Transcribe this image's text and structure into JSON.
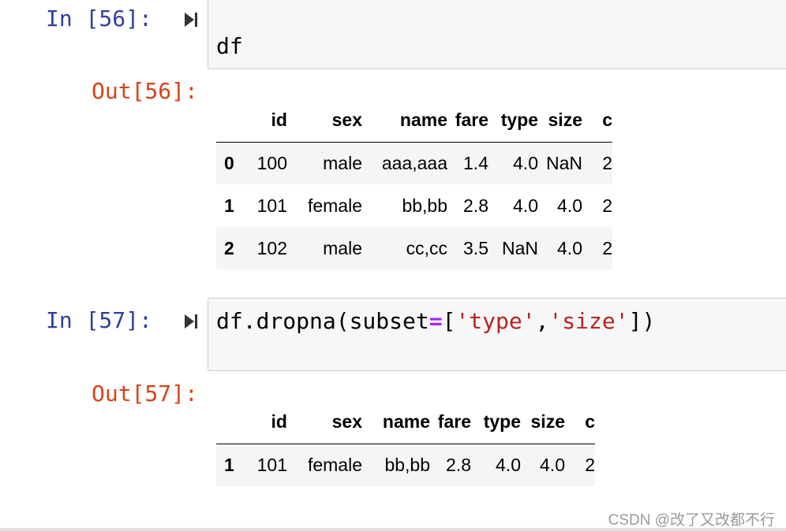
{
  "cells": [
    {
      "in_prompt": "In [56]:",
      "out_prompt": "Out[56]:",
      "code_tokens": [
        {
          "t": "df",
          "k": "plain"
        }
      ],
      "table": {
        "columns": [
          "",
          "id",
          "sex",
          "name",
          "fare",
          "type",
          "size",
          "c"
        ],
        "rows": [
          [
            "0",
            "100",
            "male",
            "aaa,aaa",
            "1.4",
            "4.0",
            "NaN",
            "2"
          ],
          [
            "1",
            "101",
            "female",
            "bb,bb",
            "2.8",
            "4.0",
            "4.0",
            "2"
          ],
          [
            "2",
            "102",
            "male",
            "cc,cc",
            "3.5",
            "NaN",
            "4.0",
            "2"
          ]
        ]
      }
    },
    {
      "in_prompt": "In [57]:",
      "out_prompt": "Out[57]:",
      "code_tokens": [
        {
          "t": "df.dropna(subset",
          "k": "plain"
        },
        {
          "t": "=",
          "k": "op"
        },
        {
          "t": "[",
          "k": "plain"
        },
        {
          "t": "'type'",
          "k": "str"
        },
        {
          "t": ",",
          "k": "plain"
        },
        {
          "t": "'size'",
          "k": "str"
        },
        {
          "t": "])",
          "k": "plain"
        }
      ],
      "table": {
        "columns": [
          "",
          "id",
          "sex",
          "name",
          "fare",
          "type",
          "size",
          "c"
        ],
        "rows": [
          [
            "1",
            "101",
            "female",
            "bb,bb",
            "2.8",
            "4.0",
            "4.0",
            "2"
          ]
        ]
      }
    }
  ],
  "watermark": "CSDN @改了又改都不行",
  "icons": {
    "run": "run-cell-icon"
  }
}
